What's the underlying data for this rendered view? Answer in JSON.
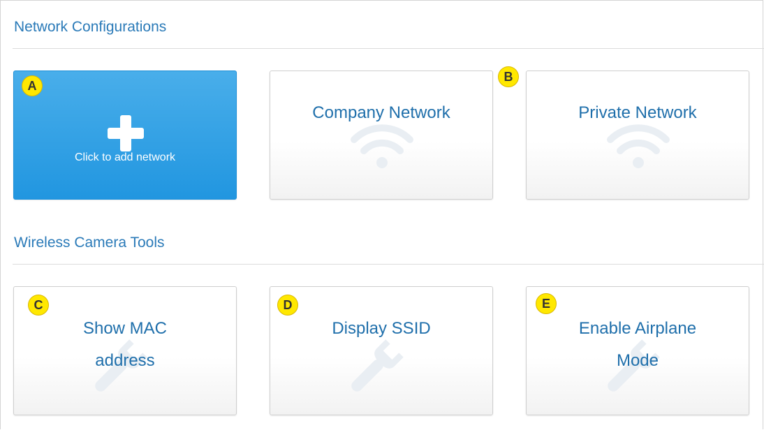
{
  "sections": {
    "network": {
      "title": "Network Configurations",
      "add_tile": {
        "label": "Click to add network",
        "badge": "A",
        "icon": "plus-icon"
      },
      "tiles": [
        {
          "label": "Company Network",
          "icon": "wifi-icon"
        },
        {
          "label": "Private Network",
          "icon": "wifi-icon",
          "badge": "B"
        }
      ]
    },
    "tools": {
      "title": "Wireless Camera Tools",
      "tiles": [
        {
          "line1": "Show MAC",
          "line2": "address",
          "icon": "wrench-icon",
          "badge": "C"
        },
        {
          "line1": "Display SSID",
          "icon": "wrench-icon",
          "badge": "D"
        },
        {
          "line1": "Enable Airplane",
          "line2": "Mode",
          "icon": "wrench-icon",
          "badge": "E"
        }
      ]
    }
  },
  "colors": {
    "accent": "#2a7ab8",
    "add_tile": "#2196e0",
    "badge": "#ffe800",
    "tile_text": "#1f6fab"
  }
}
